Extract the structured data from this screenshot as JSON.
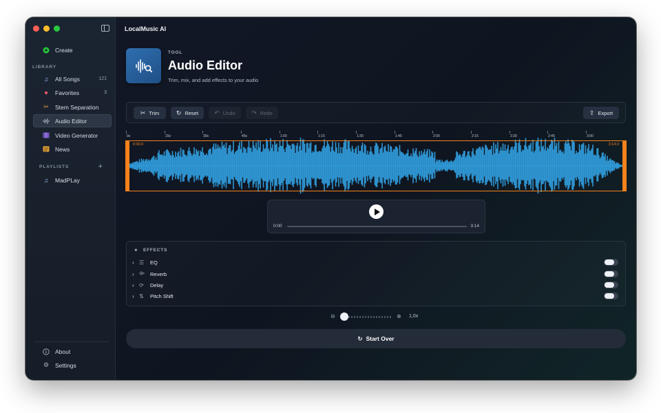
{
  "app": {
    "title": "LocalMusic AI"
  },
  "sidebar": {
    "create_label": "Create",
    "library_label": "LIBRARY",
    "items": [
      {
        "label": "All Songs",
        "count": "121",
        "icon": "music-note-icon"
      },
      {
        "label": "Favorites",
        "count": "3",
        "icon": "heart-icon"
      },
      {
        "label": "Stem Separation",
        "count": "",
        "icon": "scissors-icon"
      },
      {
        "label": "Audio Editor",
        "count": "",
        "icon": "waveform-icon",
        "active": true
      },
      {
        "label": "Video Generator",
        "count": "",
        "icon": "film-icon"
      },
      {
        "label": "News",
        "count": "",
        "icon": "newspaper-icon"
      }
    ],
    "playlists_label": "PLAYLISTS",
    "playlists": [
      {
        "label": "MadPLay",
        "icon": "music-note-icon"
      }
    ],
    "about_label": "About",
    "settings_label": "Settings"
  },
  "header": {
    "tool_label": "TOOL",
    "title": "Audio Editor",
    "subtitle": "Trim, mix, and add effects to your audio"
  },
  "toolbar": {
    "trim_label": "Trim",
    "reset_label": "Reset",
    "undo_label": "Undo",
    "redo_label": "Redo",
    "export_label": "Export"
  },
  "timeline": {
    "ticks": [
      "0s",
      "15s",
      "30s",
      "45s",
      "1:00",
      "1:15",
      "1:30",
      "1:45",
      "2:00",
      "2:15",
      "2:30",
      "2:45",
      "3:00"
    ],
    "selection_start": "0:00.0",
    "selection_end": "3:14.0"
  },
  "player": {
    "current_time": "0:00",
    "duration": "3:14",
    "progress": 0
  },
  "effects": {
    "title": "EFFECTS",
    "items": [
      {
        "label": "EQ",
        "icon": "sliders-icon",
        "enabled": false
      },
      {
        "label": "Reverb",
        "icon": "wave-icon",
        "enabled": false
      },
      {
        "label": "Delay",
        "icon": "repeat-icon",
        "enabled": false
      },
      {
        "label": "Pitch Shift",
        "icon": "arrows-updown-icon",
        "enabled": false
      }
    ]
  },
  "zoom": {
    "value_label": "1,0x",
    "level": 0
  },
  "actions": {
    "start_over_label": "Start Over"
  },
  "colors": {
    "accent": "#f7821b",
    "waveform": "#2f98d6",
    "create": "#28c840"
  }
}
